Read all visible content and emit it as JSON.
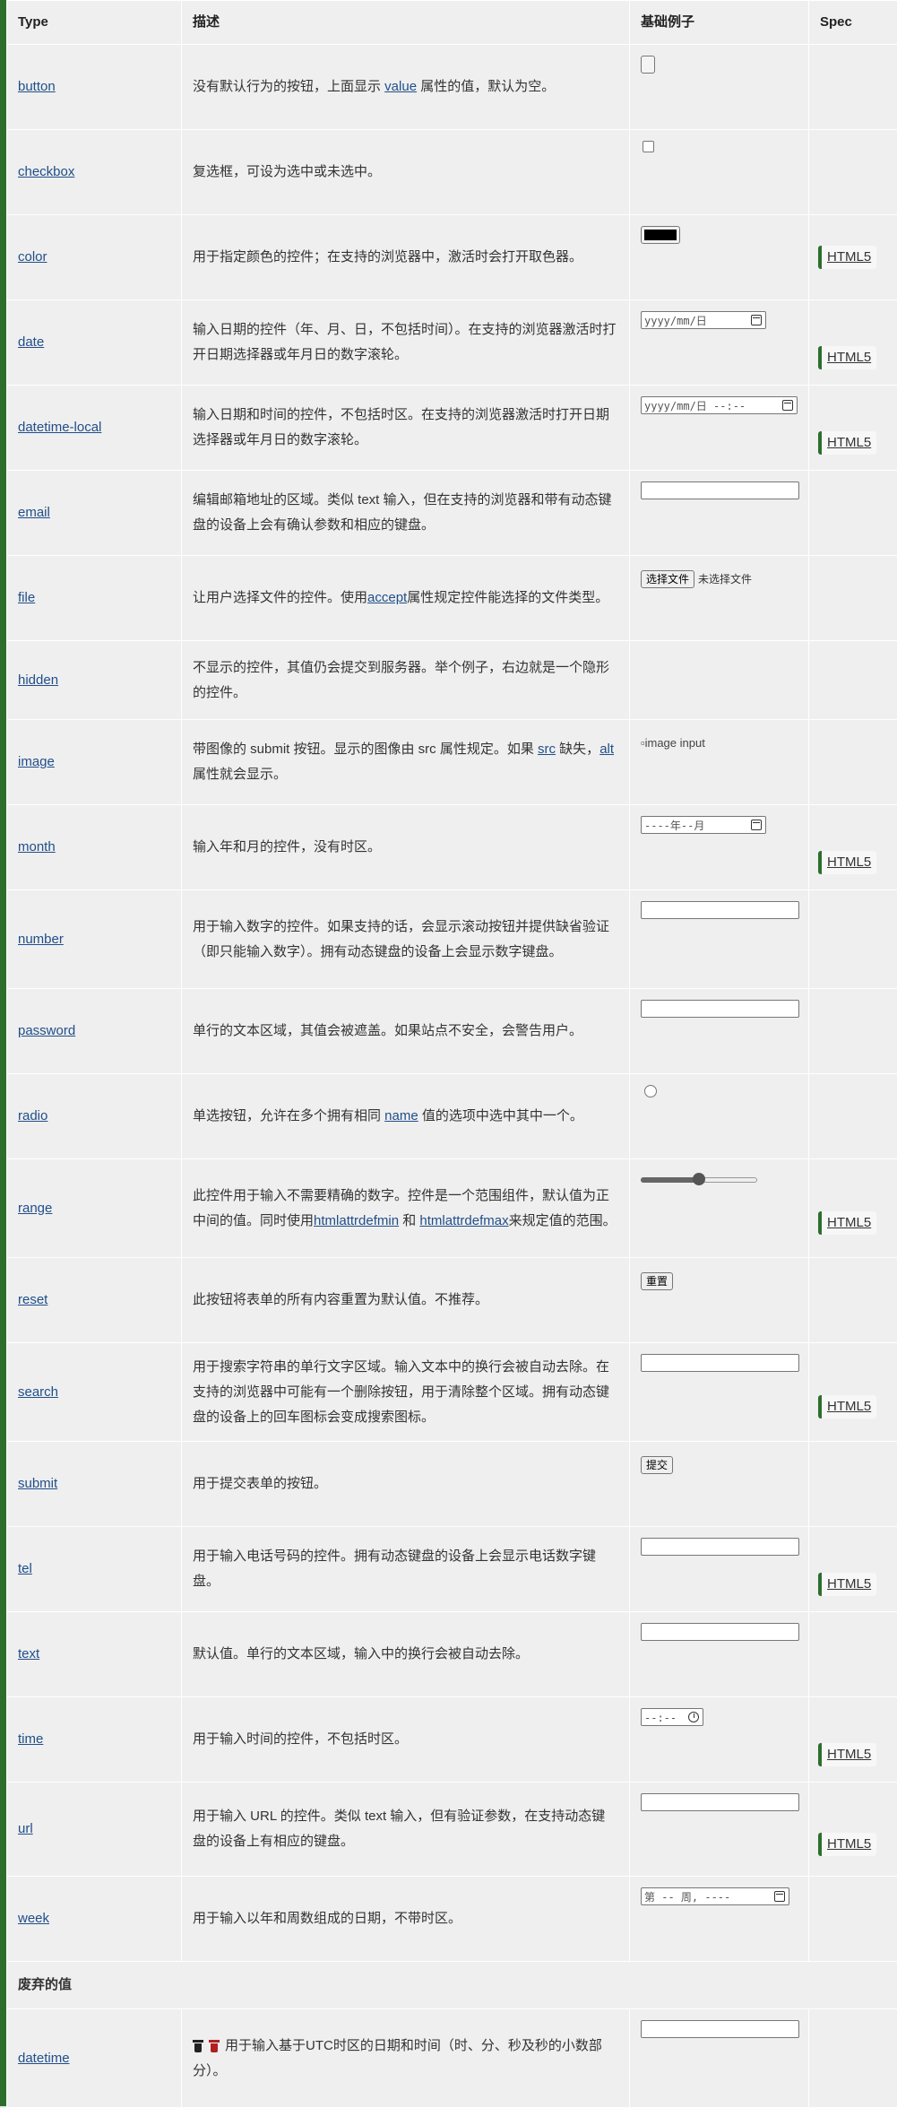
{
  "headers": {
    "type": "Type",
    "desc": "描述",
    "example": "基础例子",
    "spec": "Spec"
  },
  "colors": {
    "accent_bar": "#2d6e2d",
    "link": "#1f4e8a",
    "background": "#efefef"
  },
  "rows": [
    {
      "type": "button",
      "desc_parts": [
        "没有默认行为的按钮，上面显示 ",
        "value",
        " 属性的值，默认为空。"
      ],
      "example": "button",
      "spec": ""
    },
    {
      "type": "checkbox",
      "desc": "复选框，可设为选中或未选中。",
      "example": "checkbox",
      "spec": ""
    },
    {
      "type": "color",
      "desc": "用于指定颜色的控件；在支持的浏览器中，激活时会打开取色器。",
      "example": "color",
      "example_value": "#000000",
      "spec": "HTML5"
    },
    {
      "type": "date",
      "desc": "输入日期的控件（年、月、日，不包括时间）。在支持的浏览器激活时打开日期选择器或年月日的数字滚轮。",
      "example": "date",
      "placeholder": "yyyy/mm/日",
      "spec": "HTML5"
    },
    {
      "type": "datetime-local",
      "desc": "输入日期和时间的控件，不包括时区。在支持的浏览器激活时打开日期选择器或年月日的数字滚轮。",
      "example": "datetime-local",
      "placeholder": "yyyy/mm/日 --:--",
      "spec": "HTML5"
    },
    {
      "type": "email",
      "desc": "编辑邮箱地址的区域。类似 text 输入，但在支持的浏览器和带有动态键盘的设备上会有确认参数和相应的键盘。",
      "example": "text",
      "spec": ""
    },
    {
      "type": "file",
      "desc_parts": [
        "让用户选择文件的控件。使用",
        "accept",
        "属性规定控件能选择的文件类型。"
      ],
      "example": "file",
      "file_button": "选择文件",
      "file_status": "未选择文件",
      "spec": ""
    },
    {
      "type": "hidden",
      "desc": "不显示的控件，其值仍会提交到服务器。举个例子，右边就是一个隐形的控件。",
      "example": "none",
      "spec": ""
    },
    {
      "type": "image",
      "desc_parts": [
        "带图像的 submit 按钮。显示的图像由 src 属性规定。如果 ",
        "src",
        " 缺失，",
        "alt",
        " 属性就会显示。"
      ],
      "example": "image",
      "image_alt": "image input",
      "spec": ""
    },
    {
      "type": "month",
      "desc": "输入年和月的控件，没有时区。",
      "example": "date",
      "placeholder": "----年--月",
      "spec": "HTML5"
    },
    {
      "type": "number",
      "desc": "用于输入数字的控件。如果支持的话，会显示滚动按钮并提供缺省验证（即只能输入数字）。拥有动态键盘的设备上会显示数字键盘。",
      "example": "text",
      "spec": ""
    },
    {
      "type": "password",
      "desc": "单行的文本区域，其值会被遮盖。如果站点不安全，会警告用户。",
      "example": "text",
      "spec": ""
    },
    {
      "type": "radio",
      "desc_parts": [
        "单选按钮，允许在多个拥有相同 ",
        "name",
        " 值的选项中选中其中一个。"
      ],
      "example": "radio",
      "spec": ""
    },
    {
      "type": "range",
      "desc_parts": [
        "此控件用于输入不需要精确的数字。控件是一个范围组件，默认值为正中间的值。同时使用",
        "htmlattrdefmin",
        " 和 ",
        "htmlattrdefmax",
        "来规定值的范围。"
      ],
      "example": "range",
      "range_value": 0.5,
      "spec": "HTML5"
    },
    {
      "type": "reset",
      "desc": "此按钮将表单的所有内容重置为默认值。不推荐。",
      "example": "pushbutton",
      "button_label": "重置",
      "spec": ""
    },
    {
      "type": "search",
      "desc": "用于搜索字符串的单行文字区域。输入文本中的换行会被自动去除。在支持的浏览器中可能有一个删除按钮，用于清除整个区域。拥有动态键盘的设备上的回车图标会变成搜索图标。",
      "example": "text",
      "spec": "HTML5"
    },
    {
      "type": "submit",
      "desc": "用于提交表单的按钮。",
      "example": "pushbutton",
      "button_label": "提交",
      "spec": ""
    },
    {
      "type": "tel",
      "desc": "用于输入电话号码的控件。拥有动态键盘的设备上会显示电话数字键盘。",
      "example": "text",
      "spec": "HTML5"
    },
    {
      "type": "text",
      "desc": "默认值。单行的文本区域，输入中的换行会被自动去除。",
      "example": "text",
      "spec": ""
    },
    {
      "type": "time",
      "desc": "用于输入时间的控件，不包括时区。",
      "example": "time",
      "placeholder": "--:--",
      "spec": "HTML5"
    },
    {
      "type": "url",
      "desc": "用于输入 URL 的控件。类似 text 输入，但有验证参数，在支持动态键盘的设备上有相应的键盘。",
      "example": "text",
      "spec": "HTML5"
    },
    {
      "type": "week",
      "desc": "用于输入以年和周数组成的日期，不带时区。",
      "example": "date",
      "placeholder": "第 -- 周, ----",
      "spec": ""
    }
  ],
  "deprecated": {
    "title": "废弃的值",
    "rows": [
      {
        "type": "datetime",
        "icons": [
          "trash-icon",
          "deprecated-icon"
        ],
        "desc": "用于输入基于UTC时区的日期和时间（时、分、秒及秒的小数部分）。",
        "example": "text",
        "spec": ""
      }
    ]
  }
}
